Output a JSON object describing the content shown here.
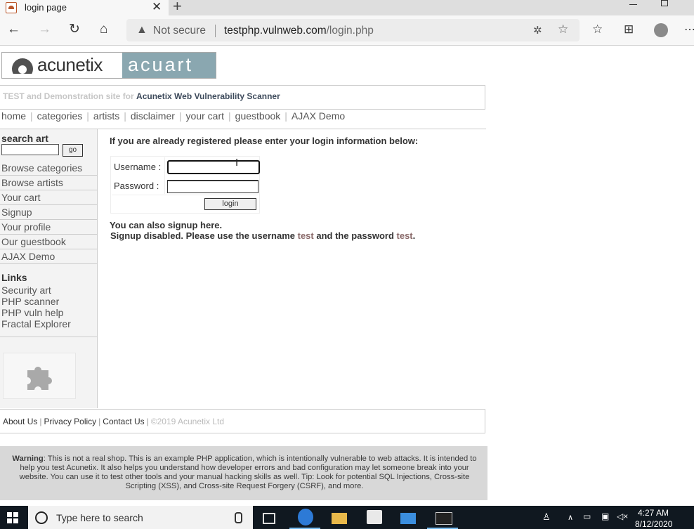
{
  "browser": {
    "tab_title": "login page",
    "new_tab": "+",
    "not_secure": "Not secure",
    "url_host": "testphp.vulnweb.com",
    "url_path": "/login.php"
  },
  "site": {
    "logo_left": "acunetix",
    "logo_right": "acuart",
    "tagline_prefix": "TEST and Demonstration site for",
    "tagline_product": "Acunetix Web Vulnerability Scanner",
    "topnav": [
      "home",
      "categories",
      "artists",
      "disclaimer",
      "your cart",
      "guestbook",
      "AJAX Demo"
    ]
  },
  "sidebar": {
    "search_title": "search art",
    "search_button": "go",
    "items": [
      "Browse categories",
      "Browse artists",
      "Your cart",
      "Signup",
      "Your profile",
      "Our guestbook",
      "AJAX Demo"
    ],
    "links_title": "Links",
    "links": [
      "Security art",
      "PHP scanner",
      "PHP vuln help",
      "Fractal Explorer"
    ]
  },
  "login": {
    "heading": "If you are already registered please enter your login information below:",
    "username_label": "Username :",
    "password_label": "Password :",
    "username_value": "",
    "password_value": "",
    "button": "login"
  },
  "signup": {
    "line1": "You can also signup here.",
    "line2_a": "Signup disabled. Please use the username",
    "username": "test",
    "line2_b": "and the password",
    "password": "test",
    "line2_end": "."
  },
  "footer": {
    "about": "About Us",
    "privacy": "Privacy Policy",
    "contact": "Contact Us",
    "copyright": "©2019 Acunetix Ltd"
  },
  "warning": {
    "label": "Warning",
    "text": ": This is not a real shop. This is an example PHP application, which is intentionally vulnerable to web attacks. It is intended to help you test Acunetix. It also helps you understand how developer errors and bad configuration may let someone break into your website. You can use it to test other tools and your manual hacking skills as well. Tip: Look for potential SQL Injections, Cross-site Scripting (XSS), and Cross-site Request Forgery (CSRF), and more."
  },
  "taskbar": {
    "search_placeholder": "Type here to search",
    "time": "4:27 AM",
    "date": "8/12/2020"
  }
}
